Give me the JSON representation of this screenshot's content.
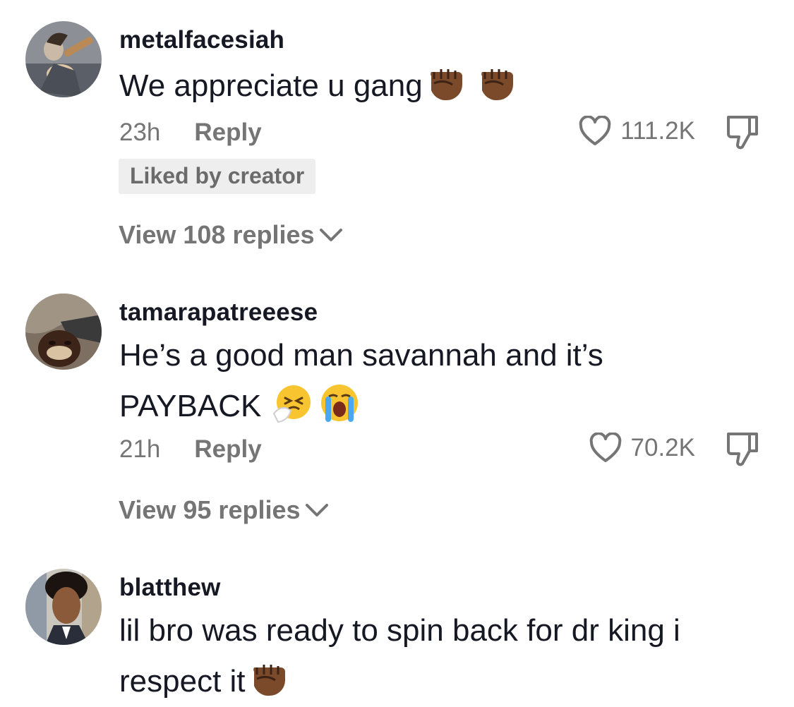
{
  "comments": [
    {
      "username": "metalfacesiah",
      "text": "We appreciate u gang",
      "emojis": [
        "raised-fist-dark",
        "raised-fist-dark"
      ],
      "time": "23h",
      "reply_label": "Reply",
      "likes": "111.2K",
      "badge": "Liked by creator",
      "view_replies": "View 108 replies"
    },
    {
      "username": "tamarapatreeese",
      "text_line1": "He’s a good man savannah and it’s",
      "text_line2": "PAYBACK",
      "emojis": [
        "sneezing-face",
        "loudly-crying-face"
      ],
      "time": "21h",
      "reply_label": "Reply",
      "likes": "70.2K",
      "view_replies": "View 95 replies"
    },
    {
      "username": "blatthew",
      "text_line1": "lil bro was ready to spin back for dr king i",
      "text_line2": "respect it",
      "emojis": [
        "raised-fist-dark"
      ]
    }
  ],
  "colors": {
    "text": "#161823",
    "muted": "#757575",
    "badge_bg": "#eeeeee",
    "fist": "#7a4a2a"
  }
}
